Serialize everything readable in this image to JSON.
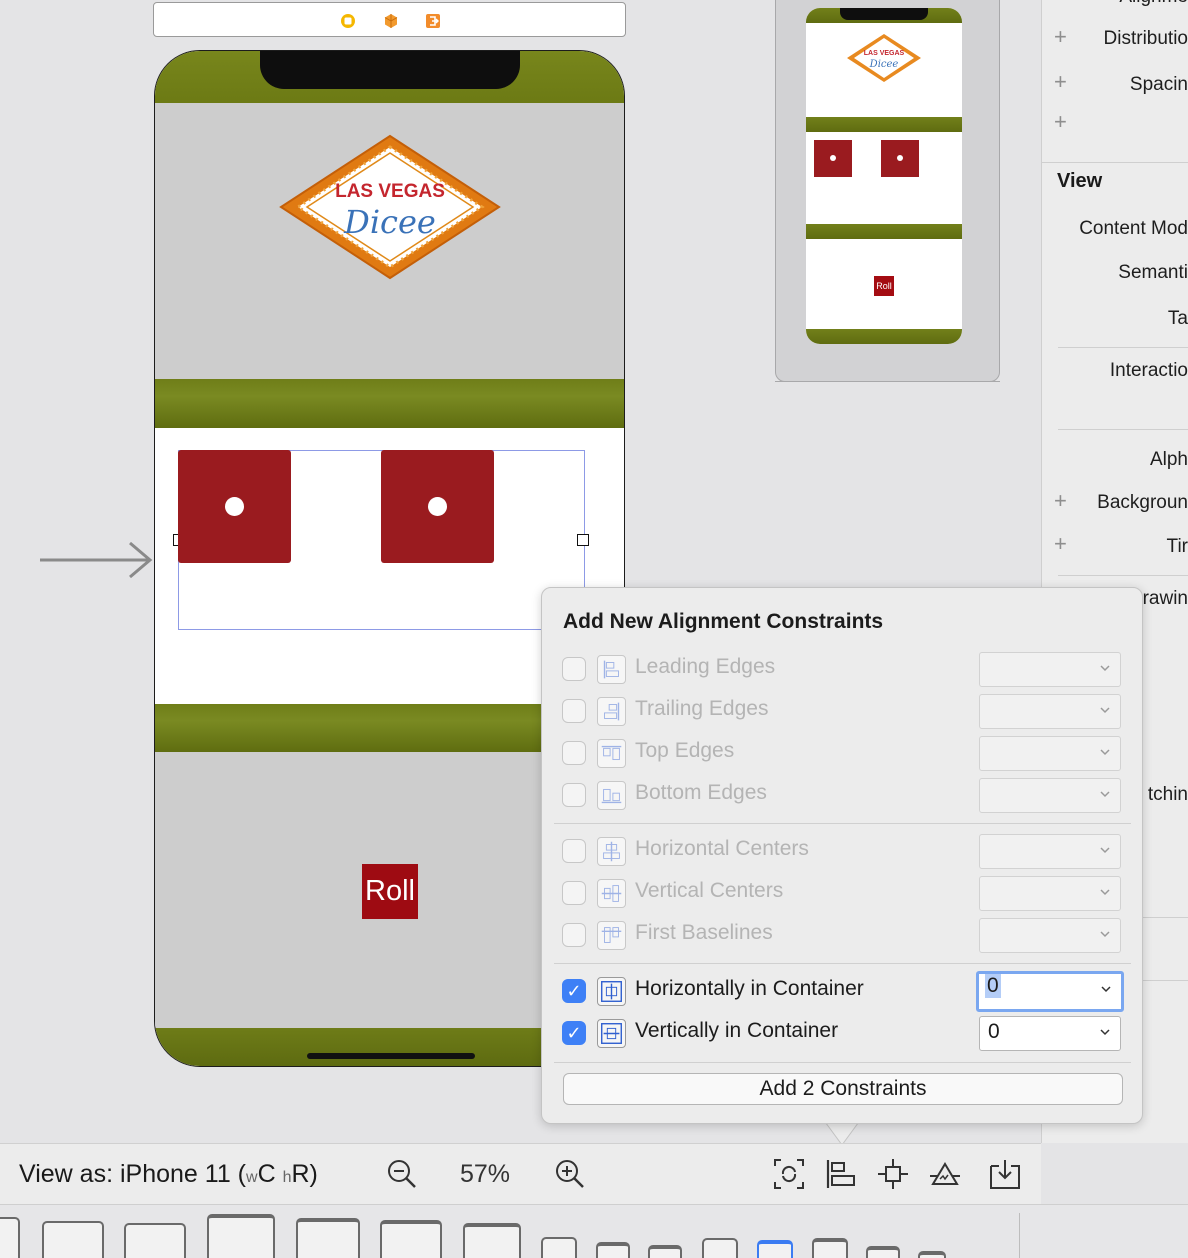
{
  "canvas": {
    "roll_label": "Roll",
    "logo_line1": "LAS VEGAS",
    "logo_line2": "Dicee",
    "mini_roll_label": "Roll",
    "mini_logo_line1": "LAS VEGAS",
    "mini_logo_line2": "Dicee"
  },
  "inspector": {
    "rows": [
      {
        "label": "Alignme",
        "plus": false
      },
      {
        "label": "Distributio",
        "plus": true
      },
      {
        "label": "Spacin",
        "plus": true
      },
      {
        "label": "",
        "plus": true
      }
    ],
    "view_heading": "View",
    "view_rows": [
      "Content Mod",
      "Semanti",
      "Ta",
      "Interactio",
      "Alph",
      "Backgroun",
      "Tir",
      "rawin",
      "tchin"
    ]
  },
  "popover": {
    "title": "Add New Alignment Constraints",
    "edge_rows": [
      {
        "label": "Leading Edges",
        "checked": false,
        "value": ""
      },
      {
        "label": "Trailing Edges",
        "checked": false,
        "value": ""
      },
      {
        "label": "Top Edges",
        "checked": false,
        "value": ""
      },
      {
        "label": "Bottom Edges",
        "checked": false,
        "value": ""
      }
    ],
    "center_rows": [
      {
        "label": "Horizontal Centers",
        "checked": false,
        "value": ""
      },
      {
        "label": "Vertical Centers",
        "checked": false,
        "value": ""
      },
      {
        "label": "First Baselines",
        "checked": false,
        "value": ""
      }
    ],
    "container_rows": [
      {
        "label": "Horizontally in Container",
        "checked": true,
        "value": "0"
      },
      {
        "label": "Vertically in Container",
        "checked": true,
        "value": "0"
      }
    ],
    "checkmark": "✓",
    "add_button": "Add 2 Constraints"
  },
  "toolbar": {
    "view_as_prefix": "View as: iPhone 11 (",
    "w_small": "w",
    "w_class": "C",
    "h_small": "h",
    "h_class": "R",
    "view_as_suffix": ")",
    "zoom": "57%",
    "icons": [
      "zoom-out-icon",
      "zoom-in-icon",
      "update-frames-icon",
      "align-icon",
      "add-constraints-icon",
      "resolve-issues-icon",
      "embed-in-icon"
    ]
  },
  "colors": {
    "accent": "#3e80f6",
    "die_red": "#9a1b1f",
    "roll_red": "#9e0b12",
    "felt_green": "#6f7e18",
    "selection": "#8d9ae6"
  }
}
